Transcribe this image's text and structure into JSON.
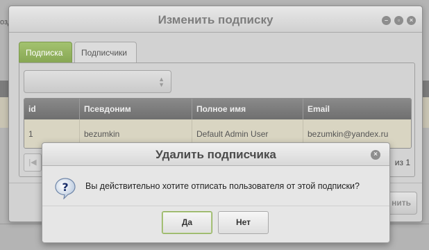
{
  "background": {
    "left_fragment": "озд"
  },
  "window": {
    "title": "Изменить подписку",
    "tabs": [
      {
        "label": "Подписка",
        "active": true
      },
      {
        "label": "Подписчики",
        "active": false
      }
    ],
    "select": {
      "value": ""
    },
    "grid": {
      "columns": [
        "id",
        "Псевдоним",
        "Полное имя",
        "Email"
      ],
      "rows": [
        {
          "id": "1",
          "nickname": "bezumkin",
          "fullname": "Default Admin User",
          "email": "bezumkin@yandex.ru"
        }
      ]
    },
    "pager": {
      "info": "из 1"
    },
    "save_label": "нить"
  },
  "dialog": {
    "title": "Удалить подписчика",
    "message": "Вы действительно хотите отписать пользователя от этой подписки?",
    "yes_label": "Да",
    "no_label": "Нет"
  },
  "colors": {
    "accent_green": "#8aab57",
    "header_gray": "#7c7c7c",
    "row_beige": "#d9d5c2"
  },
  "icons": [
    "question-icon",
    "close-icon",
    "minimize-icon",
    "maximize-icon",
    "first-page-icon",
    "select-arrows-icon"
  ]
}
